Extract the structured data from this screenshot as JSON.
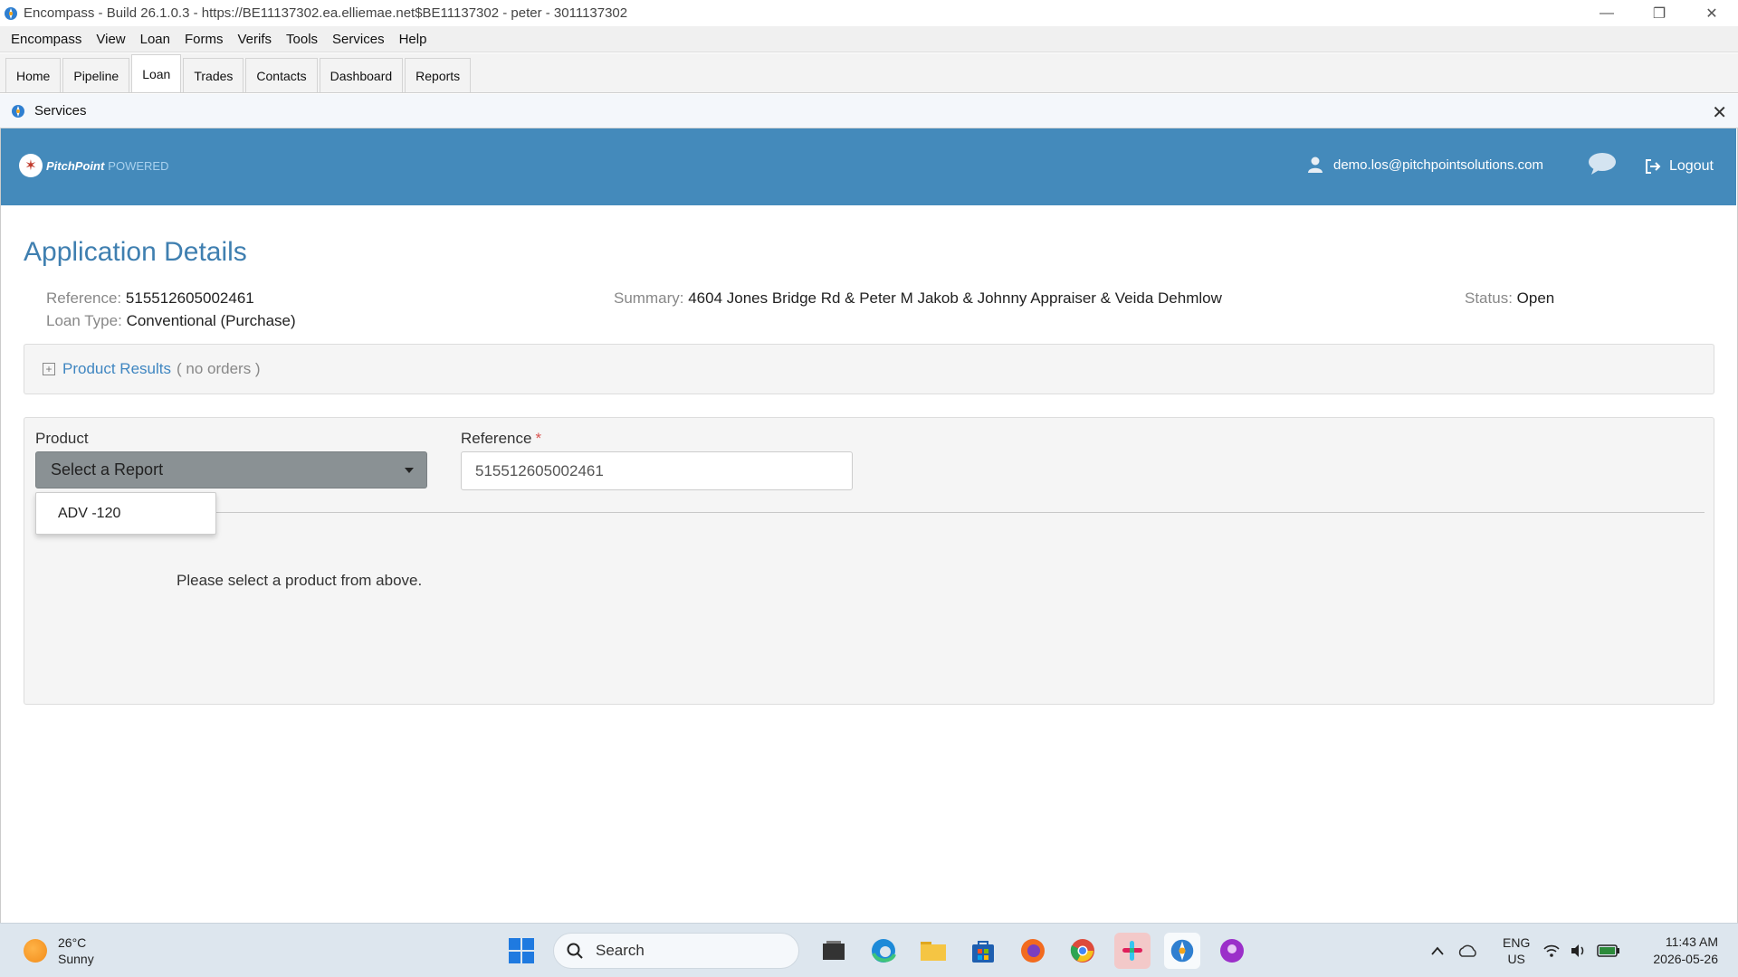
{
  "window": {
    "title": "Encompass - Build 26.1.0.3 - https://BE11137302.ea.elliemae.net$BE11137302 - peter - 3011137302",
    "controls": [
      "minimize",
      "restore",
      "close"
    ]
  },
  "menu": {
    "items": [
      "Encompass",
      "View",
      "Loan",
      "Forms",
      "Verifs",
      "Tools",
      "Services",
      "Help"
    ]
  },
  "tabs": {
    "items": [
      "Home",
      "Pipeline",
      "Loan",
      "Trades",
      "Contacts",
      "Dashboard",
      "Reports"
    ],
    "active": "Loan"
  },
  "services_panel": {
    "title": "Services"
  },
  "banner": {
    "brand_name": "PitchPoint",
    "brand_suffix": "POWERED",
    "user_email": "demo.los@pitchpointsolutions.com",
    "logout_label": "Logout",
    "color": "#448abb"
  },
  "details": {
    "title": "Application Details",
    "reference_label": "Reference:",
    "reference_value": "515512605002461",
    "loan_type_label": "Loan Type:",
    "loan_type_value": "Conventional (Purchase)",
    "summary_label": "Summary:",
    "summary_value": "4604 Jones Bridge Rd & Peter M Jakob & Johnny Appraiser & Veida Dehmlow",
    "status_label": "Status:",
    "status_value": "Open"
  },
  "product_results": {
    "label": "Product Results",
    "count_text": "( no orders )"
  },
  "order_form": {
    "product_label": "Product",
    "product_selected": "Select a Report",
    "product_options": [
      "ADV -120"
    ],
    "reference_label": "Reference",
    "reference_required_mark": "*",
    "reference_value": "515512605002461",
    "hint": "Please select a product from above."
  },
  "taskbar": {
    "weather_temp": "26°C",
    "weather_desc": "Sunny",
    "search_placeholder": "Search",
    "lang_line1": "ENG",
    "lang_line2": "US",
    "time": "11:43 AM",
    "date": "2026-05-26"
  }
}
